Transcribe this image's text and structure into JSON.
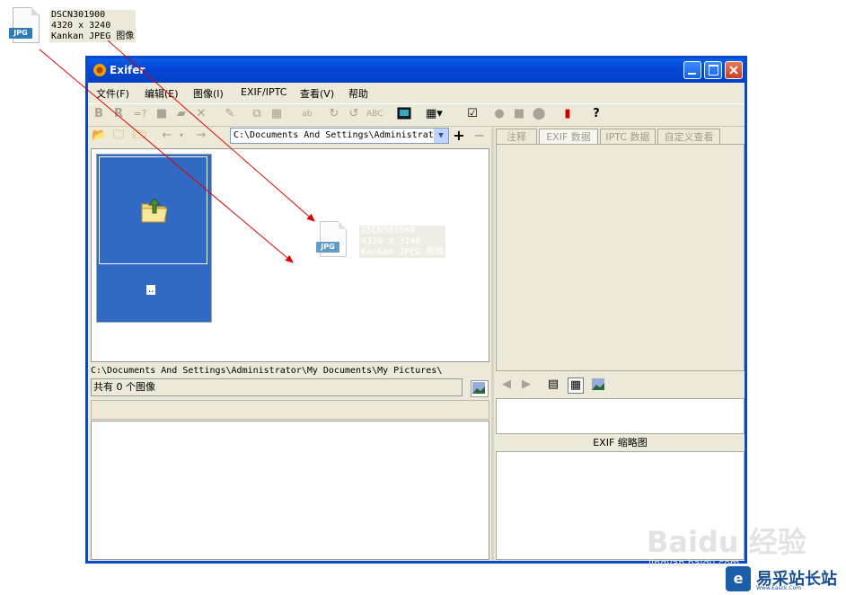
{
  "desktop_file": {
    "ext": "JPG",
    "info": "DSCN301900\n4320 x 3240\nKankan JPEG 图像"
  },
  "drag_file": {
    "ext": "JPG",
    "info": "DSCN301900\n4320 x 3240\nKankan JPEG 图像"
  },
  "window": {
    "title": "Exifer",
    "menu": [
      "文件(F)",
      "编辑(E)",
      "图像(I)",
      "EXIF/IPTC",
      "查看(V)",
      "帮助"
    ],
    "path_combo": "C:\\Documents And Settings\\Administrat",
    "thumb_label": "..",
    "current_path": "C:\\Documents And Settings\\Administrator\\My Documents\\My Pictures\\",
    "status": "共有 0 个图像",
    "tabs": [
      "注释",
      "EXIF 数据",
      "IPTC 数据",
      "自定义查看"
    ],
    "exif_thumb_caption": "EXIF 缩略图"
  },
  "watermark": {
    "text": "Baidu 经验",
    "url": "jingyan.baidu.com"
  },
  "brand": {
    "name": "易采站长站",
    "sub": "Www.Easck.Com"
  },
  "colors": {
    "title_blue": "#0848cc",
    "selection": "#316ac5",
    "window_bg": "#ece9d8",
    "arrow_red": "#e00000"
  }
}
